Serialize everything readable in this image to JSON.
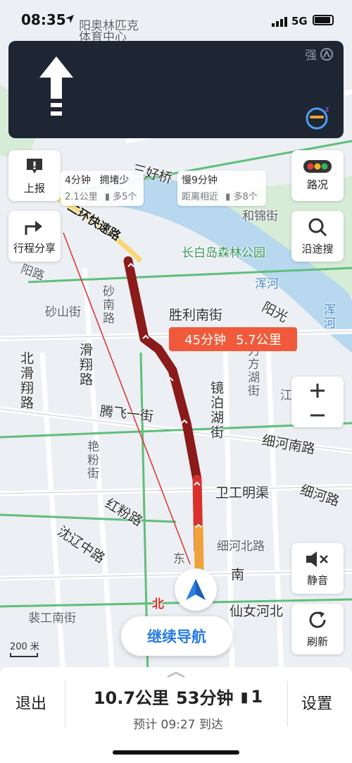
{
  "status_bar": {
    "time": "08:35",
    "network": "5G"
  },
  "nav_panel": {
    "signal_label": "强"
  },
  "side_buttons": {
    "report": "上报",
    "share": "行程分享",
    "traffic": "路况",
    "along_search": "沿途搜",
    "mute": "静音",
    "refresh": "刷新"
  },
  "alt_routes": [
    {
      "time": "4分钟",
      "status": "拥堵少",
      "detail": "2.1公里",
      "lights": "多5个"
    },
    {
      "time": "慢9分钟",
      "detail": "距离相近",
      "lights": "多8个"
    }
  ],
  "main_route": {
    "time": "45分钟",
    "distance": "5.7公里"
  },
  "map_labels": {
    "olympic": "阳奥林匹克",
    "sports_center": "体育中心",
    "haohao": "三好桥",
    "ring_road": "二环快速路",
    "hejin": "和锦街",
    "changbai": "长白岛森林公园",
    "hunhe": "浑河",
    "hunhe2": "浑河",
    "shenglinan": "胜利南街",
    "yangguang": "阳光",
    "shanan": "砂南路",
    "shashan": "砂山街",
    "huaxiang": "滑翔路",
    "beihuaxiang": "北滑翔路",
    "tengfei": "腾飞一街",
    "jingbohu": "镜泊湖街",
    "lifang": "力方湖街",
    "xihenan": "细河南路",
    "xihe": "细河路",
    "weigong": "卫工明渠",
    "xihebei": "细河北路",
    "yandu": "艳粉街",
    "hongfen": "红粉路",
    "shenliao": "沈辽中路",
    "laogong": "裴工南街",
    "xiannvhe": "仙女河北",
    "dong": "东",
    "nan": "南",
    "bei": "北",
    "zuiyang": "阳路",
    "jiang": "江"
  },
  "continue_button": "继续导航",
  "scale": "200 米",
  "bottom_bar": {
    "exit": "退出",
    "settings": "设置",
    "distance": "10.7公里",
    "duration": "53分钟",
    "lights": "1",
    "eta": "预计 09:27 到达"
  },
  "colors": {
    "route_congested": "#8b1a1a",
    "route_slow": "#d9302c",
    "route_moderate": "#f0a23a",
    "accent": "#2a7de1",
    "nav_panel_bg": "#1e2634"
  },
  "icons": [
    "location-arrow-icon",
    "signal-bars-icon",
    "battery-icon",
    "straight-arrow-icon",
    "signal-strength-icon",
    "mascot-icon",
    "report-icon",
    "share-icon",
    "traffic-light-icon",
    "search-icon",
    "zoom-in-icon",
    "zoom-out-icon",
    "mute-icon",
    "refresh-icon",
    "car-arrow-icon",
    "traffic-light-small-icon",
    "drag-handle-icon"
  ]
}
